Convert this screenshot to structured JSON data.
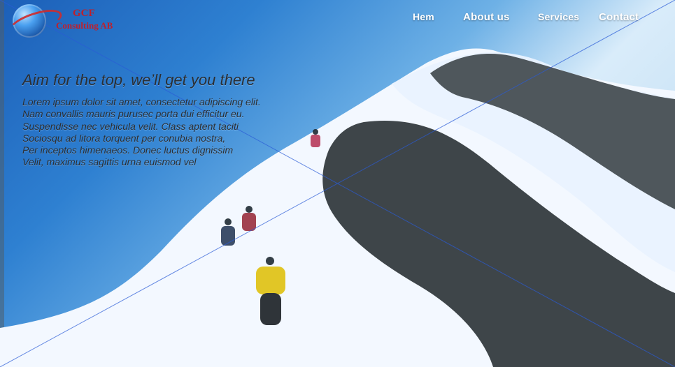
{
  "brand": {
    "name_line1": "GCF",
    "name_line2": "Consulting AB",
    "icon": "globe-logo-icon",
    "brand_red": "#c11f2a"
  },
  "nav": {
    "items": [
      {
        "label": "Hem"
      },
      {
        "label": "About us"
      },
      {
        "label": "Services"
      },
      {
        "label": "Contact"
      }
    ],
    "text_color": "#ffffff"
  },
  "hero": {
    "title": "Aim for the top, we’ll get you there",
    "body_lines": [
      "Lorem ipsum dolor sit amet, consectetur adipiscing elit.",
      "Nam convallis mauris purusec porta dui efficitur eu.",
      "Suspendisse nec vehicula velit. Class aptent taciti",
      "Sociosqu ad litora torquent per conubia nostra,",
      "Per inceptos himenaeos. Donec luctus dignissim",
      "Velit, maximus sagittis urna euismod vel"
    ]
  },
  "colors": {
    "sky_dark": "#1c5fb8",
    "sky_mid": "#2e80d1",
    "snow": "#f4f8ff",
    "rock": "#2f3539",
    "diagonal_line": "#2a5bd7"
  }
}
